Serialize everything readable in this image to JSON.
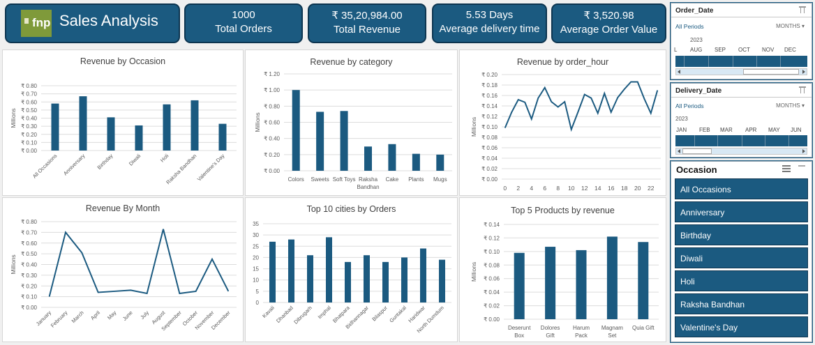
{
  "header": {
    "logo_text": "fnp",
    "title": "Sales Analysis",
    "kpis": [
      {
        "value": "1000",
        "label": "Total Orders"
      },
      {
        "value": "₹ 35,20,984.00",
        "label": "Total Revenue"
      },
      {
        "value": "5.53 Days",
        "label": "Average delivery time"
      },
      {
        "value": "₹ 3,520.98",
        "label": "Average Order Value"
      }
    ]
  },
  "colors": {
    "bar": "#1b5a80",
    "header_bg": "#1b5a80",
    "line": "#1b5a80"
  },
  "chart_data": [
    {
      "type": "bar",
      "title": "Revenue by Occasion",
      "ylabel": "Millions",
      "categories": [
        "All Occasions",
        "Anniversary",
        "Birthday",
        "Diwali",
        "Holi",
        "Raksha Bandhan",
        "Valentine's Day"
      ],
      "values": [
        0.58,
        0.67,
        0.41,
        0.31,
        0.57,
        0.62,
        0.33
      ],
      "yticks": [
        "₹ 0.00",
        "₹ 0.10",
        "₹ 0.20",
        "₹ 0.30",
        "₹ 0.40",
        "₹ 0.50",
        "₹ 0.60",
        "₹ 0.70",
        "₹ 0.80"
      ],
      "ylim": [
        0,
        0.8
      ]
    },
    {
      "type": "bar",
      "title": "Revenue by category",
      "ylabel": "Millions",
      "categories": [
        "Colors",
        "Sweets",
        "Soft Toys",
        "Raksha Bandhan",
        "Cake",
        "Plants",
        "Mugs"
      ],
      "values": [
        1.0,
        0.73,
        0.74,
        0.3,
        0.33,
        0.21,
        0.2
      ],
      "yticks": [
        "₹ 0.00",
        "₹ 0.20",
        "₹ 0.40",
        "₹ 0.60",
        "₹ 0.80",
        "₹ 1.00",
        "₹ 1.20"
      ],
      "ylim": [
        0,
        1.2
      ]
    },
    {
      "type": "line",
      "title": "Revenue by order_hour",
      "ylabel": "Millions",
      "x": [
        0,
        1,
        2,
        3,
        4,
        5,
        6,
        7,
        8,
        9,
        10,
        11,
        12,
        13,
        14,
        15,
        16,
        17,
        18,
        19,
        20,
        21,
        22,
        23
      ],
      "values": [
        0.098,
        0.128,
        0.152,
        0.147,
        0.115,
        0.155,
        0.175,
        0.148,
        0.138,
        0.148,
        0.095,
        0.128,
        0.162,
        0.155,
        0.126,
        0.164,
        0.128,
        0.156,
        0.172,
        0.186,
        0.186,
        0.154,
        0.126,
        0.17
      ],
      "xticks": [
        "0",
        "2",
        "4",
        "6",
        "8",
        "10",
        "12",
        "14",
        "16",
        "18",
        "20",
        "22"
      ],
      "yticks": [
        "₹ 0.00",
        "₹ 0.02",
        "₹ 0.04",
        "₹ 0.06",
        "₹ 0.08",
        "₹ 0.10",
        "₹ 0.12",
        "₹ 0.14",
        "₹ 0.16",
        "₹ 0.18",
        "₹ 0.20"
      ],
      "ylim": [
        0,
        0.2
      ]
    },
    {
      "type": "line",
      "title": "Revenue By Month",
      "ylabel": "Millions",
      "categories": [
        "January",
        "February",
        "March",
        "April",
        "May",
        "June",
        "July",
        "August",
        "September",
        "October",
        "November",
        "December"
      ],
      "values": [
        0.1,
        0.7,
        0.51,
        0.14,
        0.15,
        0.16,
        0.13,
        0.73,
        0.13,
        0.15,
        0.45,
        0.15
      ],
      "yticks": [
        "₹ 0.00",
        "₹ 0.10",
        "₹ 0.20",
        "₹ 0.30",
        "₹ 0.40",
        "₹ 0.50",
        "₹ 0.60",
        "₹ 0.70",
        "₹ 0.80"
      ],
      "ylim": [
        0,
        0.8
      ]
    },
    {
      "type": "bar",
      "title": "Top 10 cities by Orders",
      "categories": [
        "Kavali",
        "Dhanbad",
        "Dibrugarh",
        "Imphal",
        "Bhatpara",
        "Bidhannagar",
        "Bilaspur",
        "Guntakal",
        "Haridwar",
        "North Dumdum"
      ],
      "values": [
        27,
        28,
        21,
        29,
        18,
        21,
        18,
        20,
        24,
        19
      ],
      "yticks": [
        "0",
        "5",
        "10",
        "15",
        "20",
        "25",
        "30",
        "35"
      ],
      "ylim": [
        0,
        35
      ]
    },
    {
      "type": "bar",
      "title": "Top 5 Products by revenue",
      "ylabel": "Millions",
      "categories": [
        "Deserunt Box",
        "Dolores Gift",
        "Harum Pack",
        "Magnam Set",
        "Quia Gift"
      ],
      "values": [
        0.098,
        0.107,
        0.102,
        0.122,
        0.114
      ],
      "yticks": [
        "₹ 0.00",
        "₹ 0.02",
        "₹ 0.04",
        "₹ 0.06",
        "₹ 0.08",
        "₹ 0.10",
        "₹ 0.12",
        "₹ 0.14"
      ],
      "ylim": [
        0,
        0.14
      ]
    }
  ],
  "slicers": {
    "order_date": {
      "title": "Order_Date",
      "periods": "All Periods",
      "level": "MONTHS",
      "year": "2023",
      "months": [
        "L",
        "AUG",
        "SEP",
        "OCT",
        "NOV",
        "DEC"
      ]
    },
    "delivery_date": {
      "title": "Delivery_Date",
      "periods": "All Periods",
      "level": "MONTHS",
      "year": "2023",
      "months": [
        "JAN",
        "FEB",
        "MAR",
        "APR",
        "MAY",
        "JUN"
      ]
    },
    "occasion": {
      "title": "Occasion",
      "items": [
        "All Occasions",
        "Anniversary",
        "Birthday",
        "Diwali",
        "Holi",
        "Raksha Bandhan",
        "Valentine's Day"
      ]
    }
  }
}
